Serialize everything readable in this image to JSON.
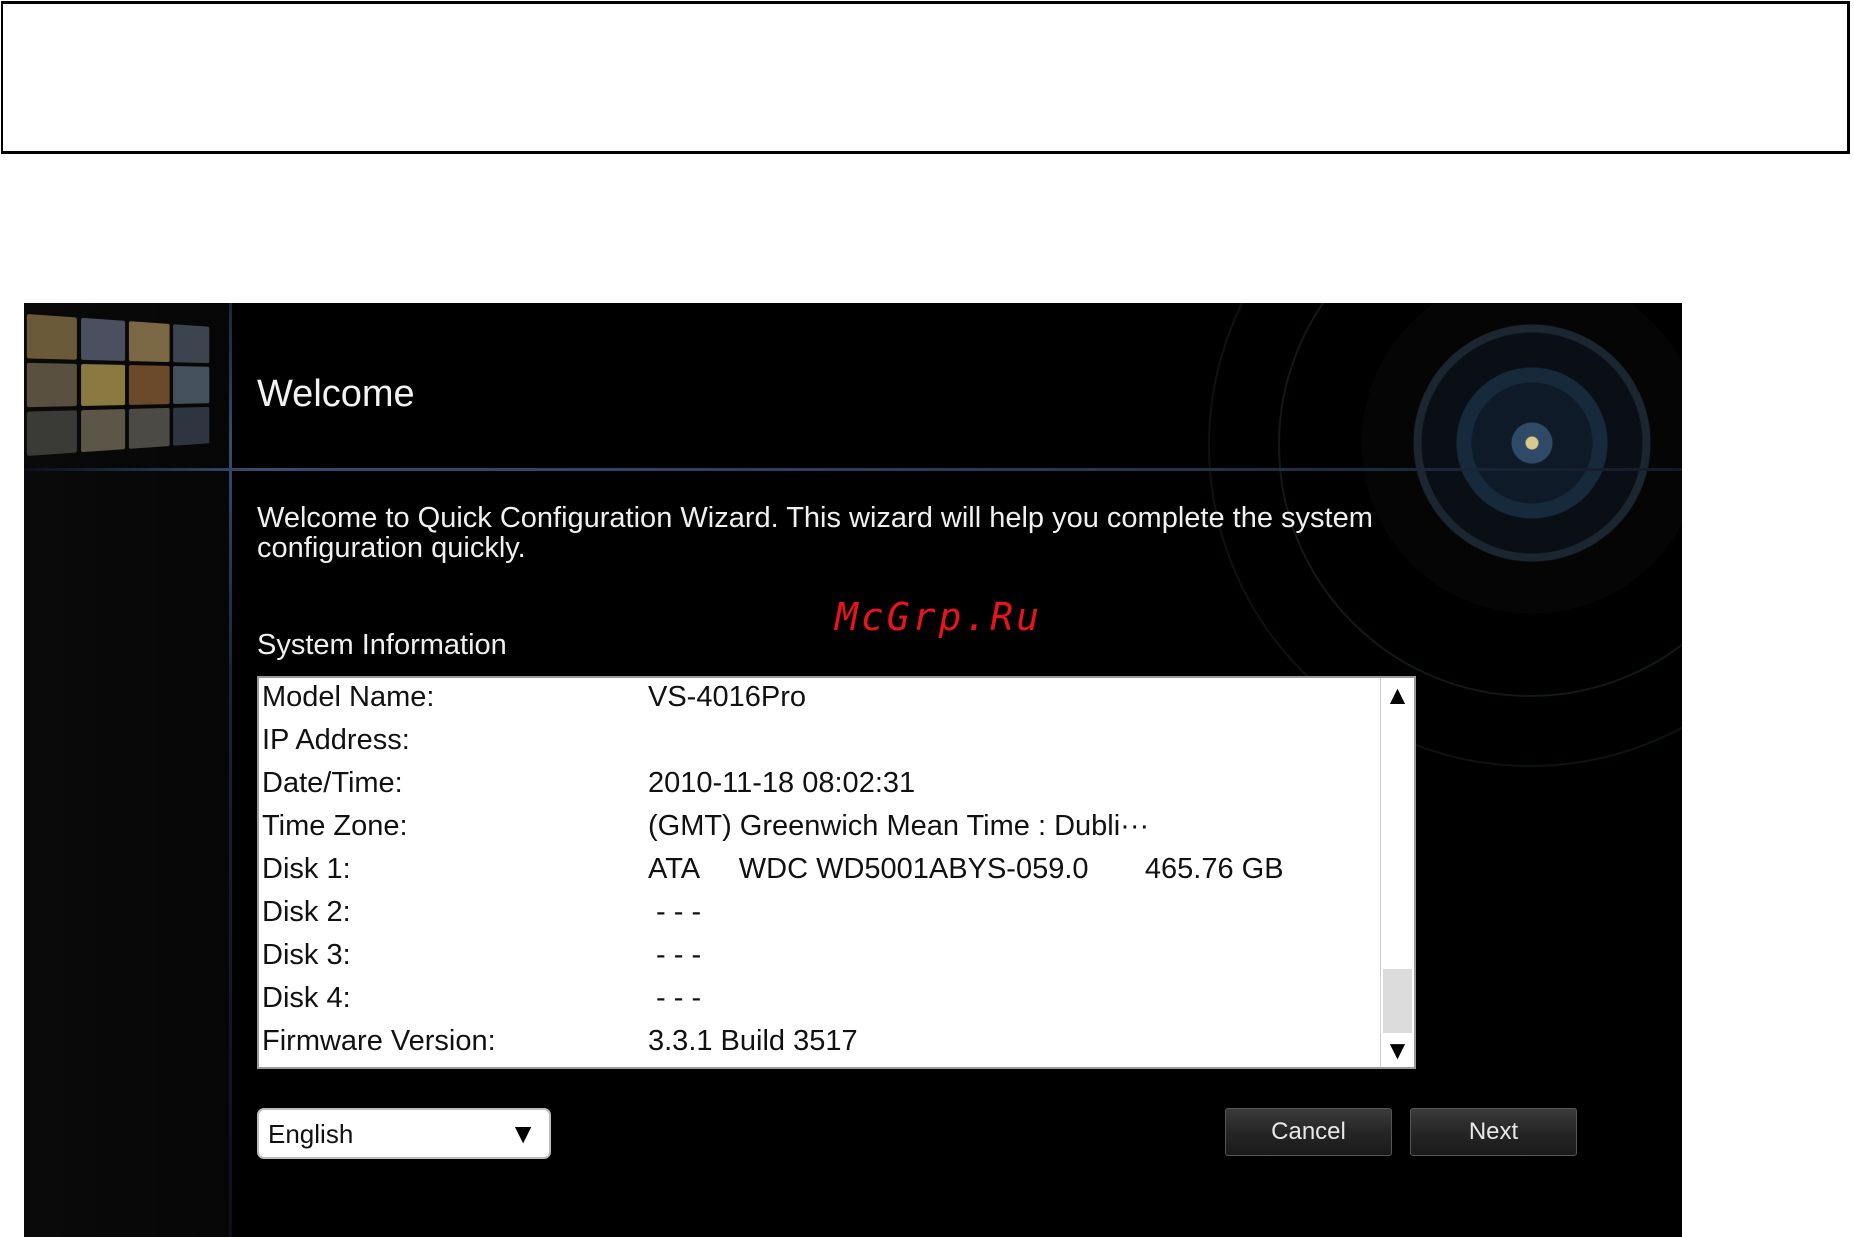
{
  "watermark": "McGrp.Ru",
  "wizard": {
    "title": "Welcome",
    "intro": "Welcome to Quick Configuration Wizard.  This wizard will help you complete the system configuration quickly.",
    "section_title": "System Information",
    "info_rows": [
      {
        "label": "Model Name:",
        "value": "VS-4016Pro"
      },
      {
        "label": "IP Address:",
        "value": ""
      },
      {
        "label": "Date/Time:",
        "value": "2010-11-18 08:02:31"
      },
      {
        "label": "Time Zone:",
        "value": "(GMT) Greenwich Mean Time : Dubli···"
      },
      {
        "label": "Disk 1:",
        "value": "ATA     WDC WD5001ABYS-059.0       465.76 GB"
      },
      {
        "label": "Disk 2:",
        "value": " - - -"
      },
      {
        "label": "Disk 3:",
        "value": " - - -"
      },
      {
        "label": "Disk 4:",
        "value": " - - -"
      },
      {
        "label": "Firmware Version:",
        "value": "3.3.1 Build 3517"
      }
    ],
    "language": {
      "selected": "English"
    },
    "buttons": {
      "cancel": "Cancel",
      "next": "Next"
    }
  },
  "icons": {
    "scroll_up": "scroll-up-arrow-icon",
    "scroll_down": "scroll-down-arrow-icon",
    "dropdown": "dropdown-arrow-icon"
  },
  "colors": {
    "background": "#000000",
    "accent_line": "#3a4a70",
    "watermark": "#e8141c"
  }
}
